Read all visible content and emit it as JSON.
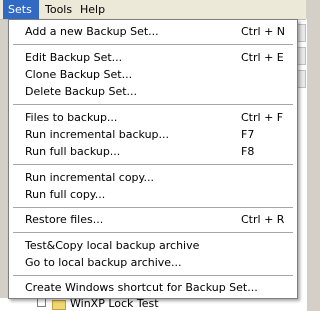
{
  "menubar": {
    "sets": "Sets",
    "tools": "Tools",
    "help": "Help"
  },
  "background": {
    "tree_item_label": "WinXP Lock Test"
  },
  "menu": {
    "add_backup_set": {
      "label": "Add a new Backup Set...",
      "shortcut": "Ctrl + N"
    },
    "edit_backup_set": {
      "label": "Edit Backup Set...",
      "shortcut": "Ctrl + E"
    },
    "clone_backup_set": {
      "label": "Clone Backup Set..."
    },
    "delete_backup_set": {
      "label": "Delete Backup Set..."
    },
    "files_to_backup": {
      "label": "Files to backup...",
      "shortcut": "Ctrl + F"
    },
    "run_incremental_backup": {
      "label": "Run incremental backup...",
      "shortcut": "F7"
    },
    "run_full_backup": {
      "label": "Run full backup...",
      "shortcut": "F8"
    },
    "run_incremental_copy": {
      "label": "Run incremental copy..."
    },
    "run_full_copy": {
      "label": "Run full copy..."
    },
    "restore_files": {
      "label": "Restore files...",
      "shortcut": "Ctrl + R"
    },
    "test_copy_archive": {
      "label": "Test&Copy local backup archive"
    },
    "go_to_archive": {
      "label": "Go to local backup archive..."
    },
    "create_shortcut": {
      "label": "Create Windows shortcut for Backup Set..."
    }
  },
  "colors": {
    "menu_highlight": "#316ac5",
    "menubar_bg": "#ece9d8",
    "menu_bg": "#ffffff",
    "separator": "#a7a6aa"
  }
}
